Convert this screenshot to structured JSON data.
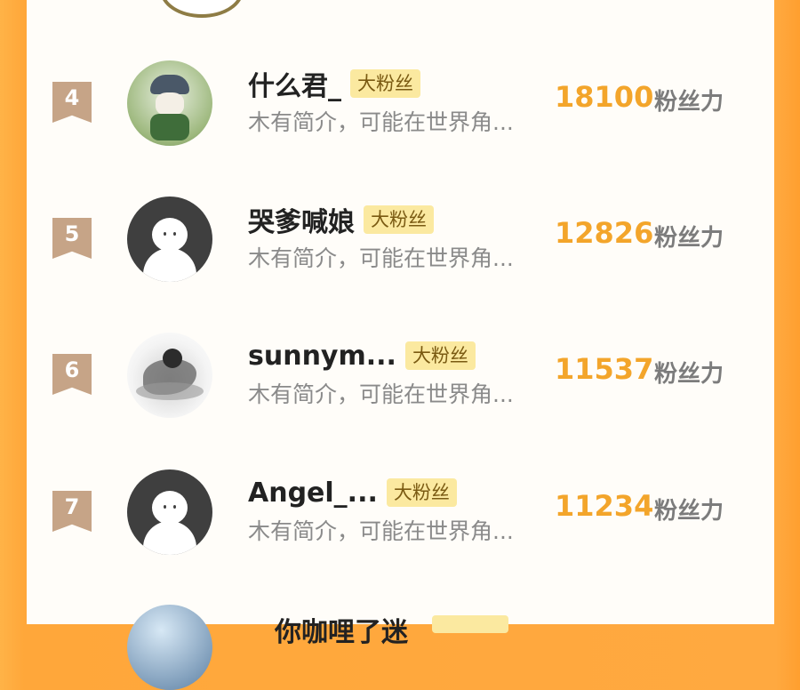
{
  "entries": [
    {
      "rank": "4",
      "name": "什么君_",
      "badge": "大粉丝",
      "bio": "木有简介，可能在世界角...",
      "score": "18100",
      "score_label": "粉丝力",
      "avatar": "green-character-avatar"
    },
    {
      "rank": "5",
      "name": "哭爹喊娘",
      "badge": "大粉丝",
      "bio": "木有简介，可能在世界角...",
      "score": "12826",
      "score_label": "粉丝力",
      "avatar": "default-avatar"
    },
    {
      "rank": "6",
      "name": "sunnym...",
      "badge": "大粉丝",
      "bio": "木有简介，可能在世界角...",
      "score": "11537",
      "score_label": "粉丝力",
      "avatar": "ink-painting-avatar"
    },
    {
      "rank": "7",
      "name": "Angel_...",
      "badge": "大粉丝",
      "bio": "木有简介，可能在世界角...",
      "score": "11234",
      "score_label": "粉丝力",
      "avatar": "default-avatar"
    }
  ],
  "partial_next": {
    "name": "你咖哩了迷"
  },
  "colors": {
    "accent": "#f3a52b",
    "badge_bg": "#fbe9a0",
    "rank_bg": "#c6a487",
    "frame": "#ffa73a"
  }
}
